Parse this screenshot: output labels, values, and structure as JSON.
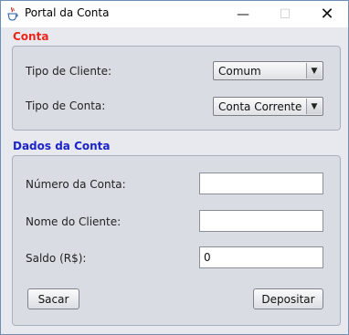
{
  "window": {
    "title": "Portal da Conta",
    "controls": {
      "minimize": "—",
      "maximize": "☐",
      "close": "✕"
    }
  },
  "conta": {
    "heading": "Conta",
    "heading_color": "#e8261c",
    "tipo_cliente": {
      "label": "Tipo de Cliente:",
      "value": "Comum"
    },
    "tipo_conta": {
      "label": "Tipo de Conta:",
      "value": "Conta Corrente"
    },
    "arrow": "▼"
  },
  "dados": {
    "heading": "Dados da Conta",
    "heading_color": "#1c23c8",
    "numero": {
      "label": "Número da Conta:",
      "value": ""
    },
    "nome": {
      "label": "Nome do Cliente:",
      "value": ""
    },
    "saldo": {
      "label": "Saldo (R$):",
      "value": "0"
    },
    "sacar_label": "Sacar",
    "depositar_label": "Depositar"
  }
}
